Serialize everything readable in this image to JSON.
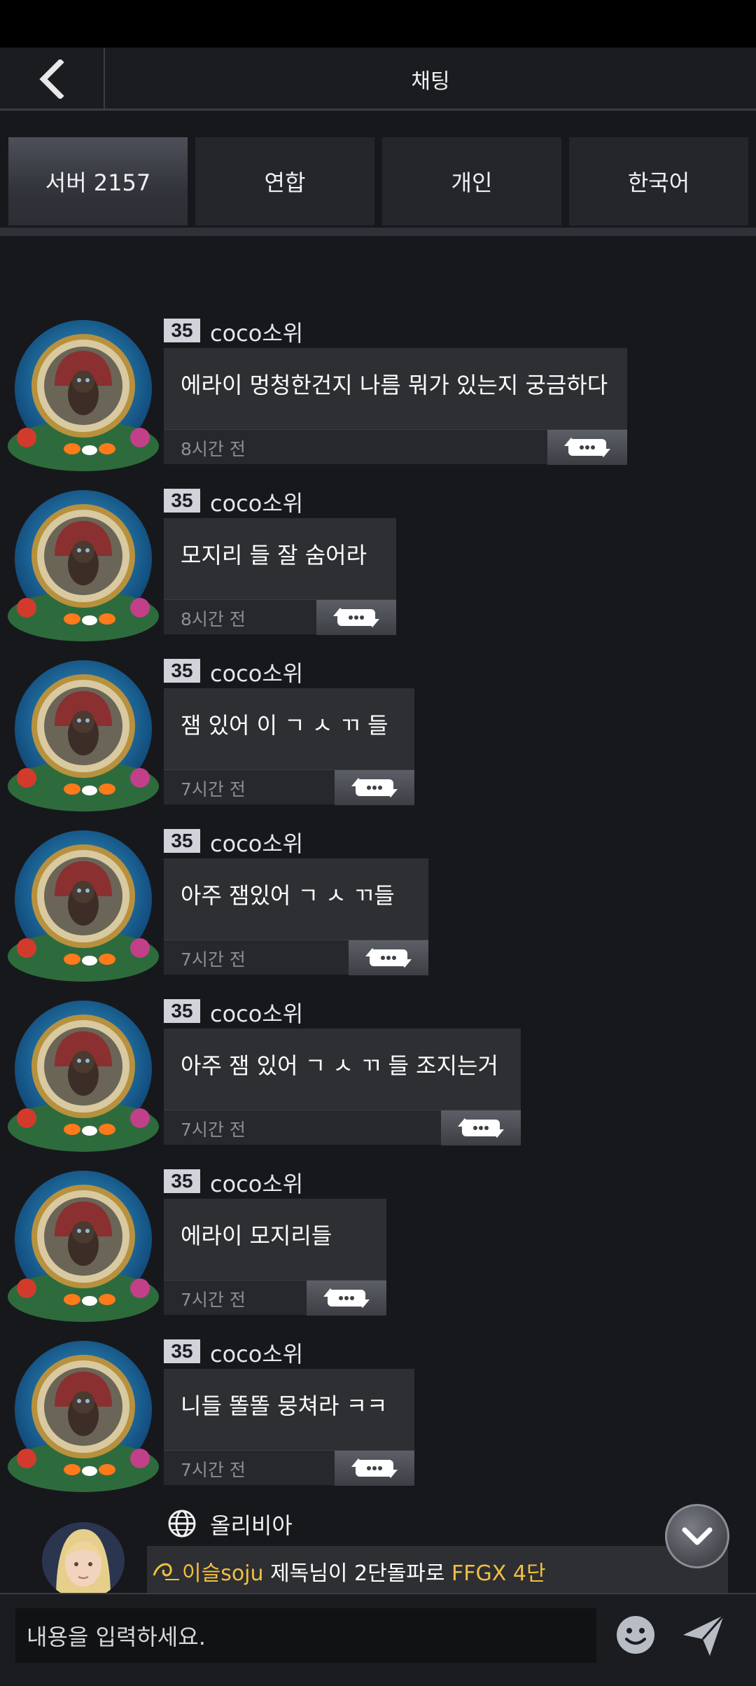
{
  "header": {
    "title": "채팅",
    "back_icon": "chevron-left-icon"
  },
  "tabs": [
    {
      "label": "서버 2157",
      "active": true
    },
    {
      "label": "연합",
      "active": false
    },
    {
      "label": "개인",
      "active": false
    },
    {
      "label": "한국어",
      "active": false
    }
  ],
  "messages": [
    {
      "level": "35",
      "name": "coco소위",
      "text": "에라이 멍청한건지 나름 뭐가 있는지 궁금하다",
      "time": "8시간 전"
    },
    {
      "level": "35",
      "name": "coco소위",
      "text": "모지리 들 잘 숨어라",
      "time": "8시간 전"
    },
    {
      "level": "35",
      "name": "coco소위",
      "text": "잼 있어 이 ㄱ ㅅ ㄲ 들",
      "time": "7시간 전"
    },
    {
      "level": "35",
      "name": "coco소위",
      "text": "아주 잼있어  ㄱ ㅅ ㄲ들",
      "time": "7시간 전"
    },
    {
      "level": "35",
      "name": "coco소위",
      "text": "아주 잼 있어 ㄱ ㅅ ㄲ 들 조지는거",
      "time": "7시간 전"
    },
    {
      "level": "35",
      "name": "coco소위",
      "text": "에라이 모지리들",
      "time": "7시간 전"
    },
    {
      "level": "35",
      "name": "coco소위",
      "text": "니들 똘똘 뭉쳐라 ㅋㅋ",
      "time": "7시간 전"
    }
  ],
  "system_message": {
    "name": "올리비아",
    "guild": "이슬soju",
    "text_before": " 제독님이 2단돌파로 ",
    "highlight": "FFGX 4단"
  },
  "input": {
    "placeholder": "내용을 입력하세요."
  },
  "colors": {
    "background": "#17181c",
    "bubble": "#2e2f33",
    "accent_gold": "#f0c040",
    "level_badge": "#d0d3da"
  }
}
